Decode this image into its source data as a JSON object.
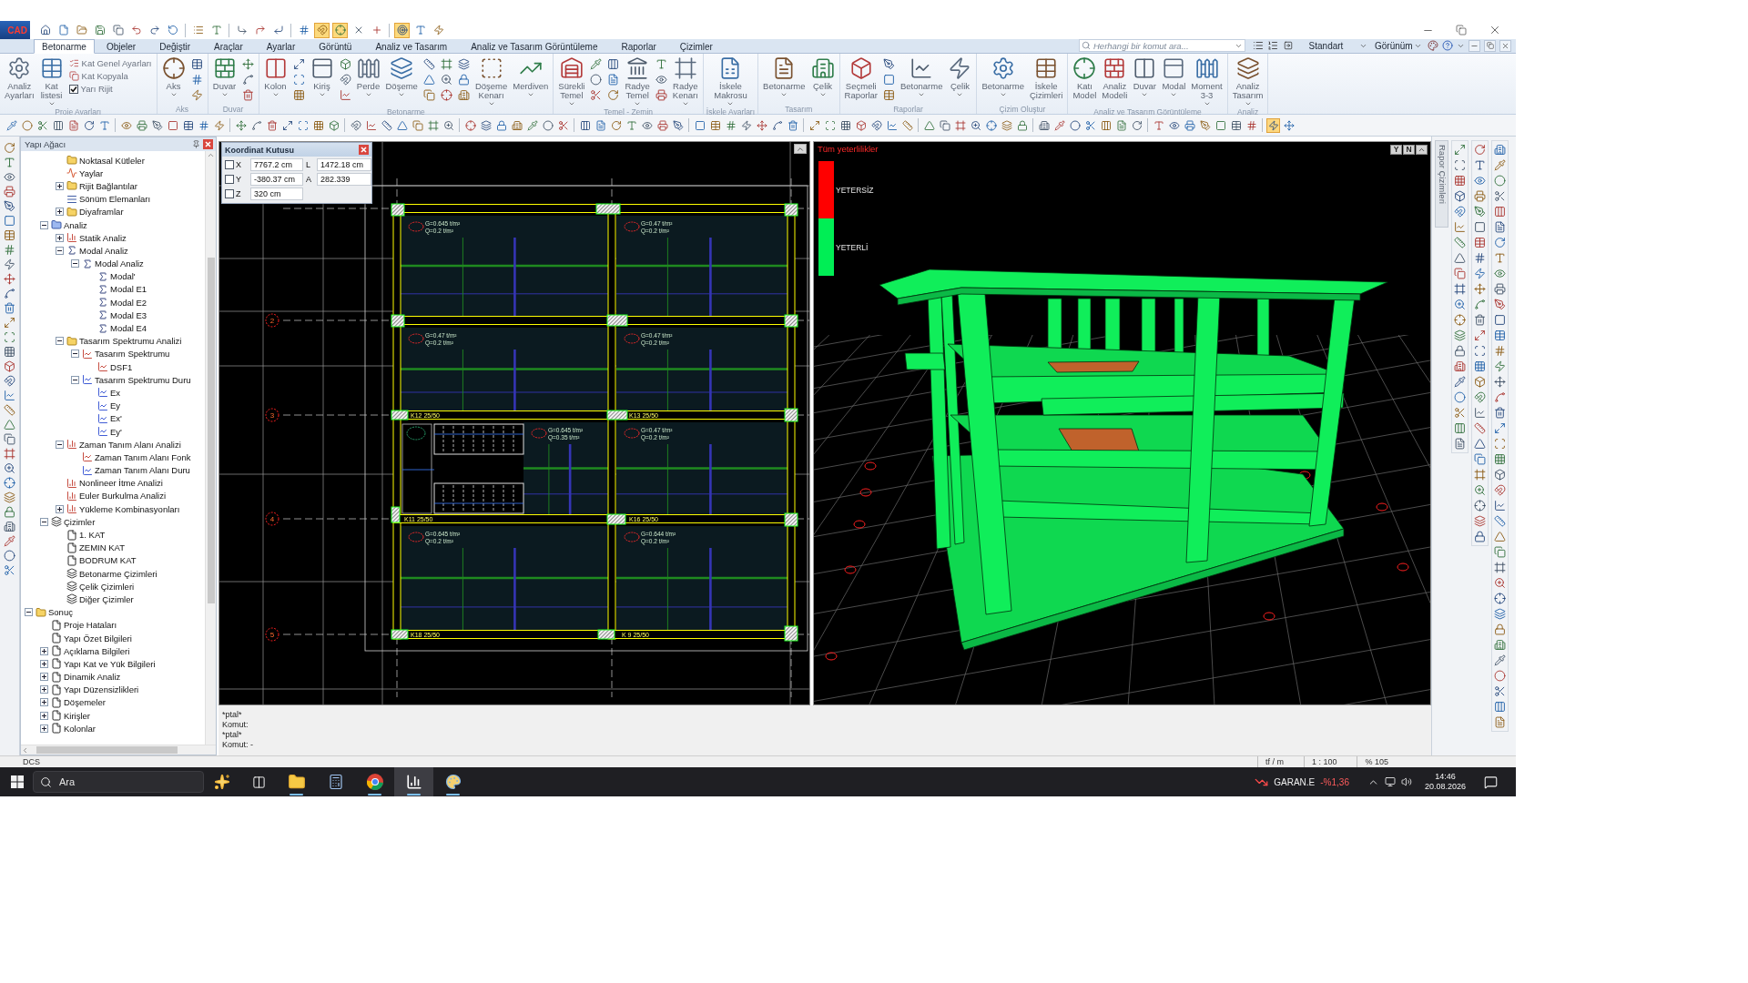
{
  "title_bar": {
    "logo": "CAD",
    "quick_access": [
      {
        "on": false
      },
      {
        "on": false
      },
      {
        "on": false
      },
      {
        "on": false
      },
      {
        "on": false
      },
      {
        "on": false
      },
      {
        "on": false
      },
      {
        "on": false
      },
      {
        "on": false
      },
      {
        "on": false
      },
      {
        "on": false
      },
      {
        "on": false
      },
      {
        "on": false
      },
      {
        "on": false
      },
      {
        "on": true
      },
      {
        "on": true
      },
      {
        "on": false
      },
      {
        "on": false
      },
      {
        "on": true
      },
      {
        "on": false
      },
      {
        "on": false
      }
    ]
  },
  "tabs": [
    {
      "label": "Betonarme",
      "selected": true
    },
    {
      "label": "Objeler",
      "selected": false
    },
    {
      "label": "Değiştir",
      "selected": false
    },
    {
      "label": "Araçlar",
      "selected": false
    },
    {
      "label": "Ayarlar",
      "selected": false
    },
    {
      "label": "Görüntü",
      "selected": false
    },
    {
      "label": "Analiz ve Tasarım",
      "selected": false
    },
    {
      "label": "Analiz ve Tasarım Görüntüleme",
      "selected": false
    },
    {
      "label": "Raporlar",
      "selected": false
    },
    {
      "label": "Çizimler",
      "selected": false
    }
  ],
  "command_search": {
    "placeholder": "Herhangi bir komut ara..."
  },
  "workspace": {
    "value": "Standart"
  },
  "view_menu": {
    "label": "Görünüm"
  },
  "ribbon": {
    "groups": [
      {
        "label": "Proje Ayarları",
        "items": [
          {
            "kind": "large",
            "label": "Analiz Ayarları",
            "dropdown": false
          },
          {
            "kind": "large",
            "label": "Kat listesi",
            "dropdown": true
          },
          {
            "kind": "list",
            "entries": [
              {
                "kind": "item",
                "label": "Kat Genel Ayarları"
              },
              {
                "kind": "item",
                "label": "Kat Kopyala"
              },
              {
                "kind": "check",
                "label": "Yarı Rijit",
                "checked": true
              }
            ]
          }
        ]
      },
      {
        "label": "Aks",
        "items": [
          {
            "kind": "large",
            "label": "Aks",
            "dropdown": true
          },
          {
            "kind": "tools"
          }
        ]
      },
      {
        "label": "Duvar",
        "items": [
          {
            "kind": "large",
            "label": "Duvar",
            "dropdown": true
          },
          {
            "kind": "tools"
          }
        ]
      },
      {
        "label": "Betonarme",
        "items": [
          {
            "kind": "large",
            "label": "Kolon",
            "dropdown": true
          },
          {
            "kind": "tools"
          },
          {
            "kind": "large",
            "label": "Kiriş",
            "dropdown": true
          },
          {
            "kind": "tools"
          },
          {
            "kind": "large",
            "label": "Perde",
            "dropdown": true
          },
          {
            "kind": "large",
            "label": "Döşeme",
            "dropdown": true
          },
          {
            "kind": "tools"
          },
          {
            "kind": "tools"
          },
          {
            "kind": "tools"
          },
          {
            "kind": "large",
            "label": "Döşeme Kenarı",
            "dropdown": true
          },
          {
            "kind": "large",
            "label": "Merdiven",
            "dropdown": true
          }
        ]
      },
      {
        "label": "Temel - Zemin",
        "items": [
          {
            "kind": "large",
            "label": "Sürekli Temel",
            "dropdown": true
          },
          {
            "kind": "tools"
          },
          {
            "kind": "tools"
          },
          {
            "kind": "large",
            "label": "Radye Temel",
            "dropdown": true
          },
          {
            "kind": "tools"
          },
          {
            "kind": "large",
            "label": "Radye Kenarı",
            "dropdown": true
          }
        ]
      },
      {
        "label": "İskele Ayarları",
        "items": [
          {
            "kind": "large",
            "label": "İskele Makrosu",
            "dropdown": true
          }
        ]
      },
      {
        "label": "Tasarım",
        "items": [
          {
            "kind": "large",
            "label": "Betonarme",
            "dropdown": true
          },
          {
            "kind": "large",
            "label": "Çelik",
            "dropdown": true
          }
        ]
      },
      {
        "label": "Raporlar",
        "items": [
          {
            "kind": "large",
            "label": "Seçmeli Raporlar",
            "dropdown": false
          },
          {
            "kind": "tools"
          },
          {
            "kind": "large",
            "label": "Betonarme",
            "dropdown": true
          },
          {
            "kind": "large",
            "label": "Çelik",
            "dropdown": true
          }
        ]
      },
      {
        "label": "Çizim Oluştur",
        "items": [
          {
            "kind": "large",
            "label": "Betonarme",
            "dropdown": true
          },
          {
            "kind": "large",
            "label": "İskele Çizimleri",
            "dropdown": false
          }
        ]
      },
      {
        "label": "Analiz ve Tasarım Görüntüleme",
        "items": [
          {
            "kind": "large",
            "label": "Katı Model",
            "dropdown": false
          },
          {
            "kind": "large",
            "label": "Analiz Modeli",
            "dropdown": false
          },
          {
            "kind": "large",
            "label": "Duvar",
            "dropdown": true
          },
          {
            "kind": "large",
            "label": "Modal",
            "dropdown": true
          },
          {
            "kind": "large",
            "label": "Moment 3-3",
            "dropdown": true
          }
        ]
      },
      {
        "label": "Analiz",
        "items": [
          {
            "kind": "large",
            "label": "Analiz Tasarım",
            "dropdown": true
          }
        ]
      }
    ]
  },
  "toolbar": [
    {
      "on": false
    },
    {
      "on": false
    },
    {
      "on": false
    },
    {
      "on": false
    },
    {
      "on": false
    },
    {
      "on": false
    },
    {
      "on": false
    },
    {
      "on": false
    },
    {
      "on": false
    },
    {
      "on": false
    },
    {
      "on": false
    },
    {
      "on": false
    },
    {
      "on": false
    },
    {
      "on": false
    },
    {
      "on": false
    },
    {
      "on": false
    },
    {
      "on": false
    },
    {
      "on": false
    },
    {
      "on": false
    },
    {
      "on": false
    },
    {
      "on": false
    },
    {
      "on": false
    },
    {
      "on": false
    },
    {
      "on": false
    },
    {
      "on": false
    },
    {
      "on": false
    },
    {
      "on": false
    },
    {
      "on": false
    },
    {
      "on": false
    },
    {
      "on": false
    },
    {
      "on": false
    },
    {
      "on": false
    },
    {
      "on": false
    },
    {
      "on": false
    },
    {
      "on": false
    },
    {
      "on": false
    },
    {
      "on": false
    },
    {
      "on": false
    },
    {
      "on": false
    },
    {
      "on": false
    },
    {
      "on": false
    },
    {
      "on": false
    },
    {
      "on": false
    },
    {
      "on": false
    },
    {
      "on": false
    },
    {
      "on": false
    },
    {
      "on": false
    },
    {
      "on": false
    },
    {
      "on": false
    },
    {
      "on": false
    },
    {
      "on": false
    },
    {
      "on": false
    },
    {
      "on": false
    },
    {
      "on": false
    },
    {
      "on": false
    },
    {
      "on": false
    },
    {
      "on": false
    },
    {
      "on": false
    },
    {
      "on": false
    },
    {
      "on": false
    },
    {
      "on": false
    },
    {
      "on": false
    },
    {
      "on": false
    },
    {
      "on": false
    },
    {
      "on": false
    },
    {
      "on": false
    },
    {
      "on": false
    },
    {
      "on": false
    },
    {
      "on": false
    },
    {
      "on": false
    },
    {
      "on": false
    },
    {
      "on": false
    },
    {
      "on": false
    },
    {
      "on": false
    },
    {
      "on": false
    },
    {
      "on": false
    },
    {
      "on": false
    },
    {
      "on": true
    },
    {
      "on": false
    }
  ],
  "tree": {
    "title": "Yapı Ağacı",
    "items": [
      {
        "children": [
          {
            "children": [
              {
                "label": "Noktasal Kütleler",
                "kind": "folder"
              },
              {
                "label": "Yaylar",
                "kind": "spring"
              },
              {
                "label": "Rijit Bağlantılar",
                "kind": "folder",
                "expanded": false
              },
              {
                "label": "Sönüm Elemanları",
                "kind": "damper"
              },
              {
                "label": "Diyaframlar",
                "kind": "folder",
                "expanded": false
              }
            ]
          },
          {
            "label": "Analiz",
            "kind": "analysis",
            "expanded": true,
            "children": [
              {
                "label": "Statik Analiz",
                "kind": "chart",
                "expanded": false
              },
              {
                "label": "Modal Analiz",
                "kind": "sigma",
                "expanded": true,
                "children": [
                  {
                    "label": "Modal Analiz",
                    "kind": "sigma",
                    "expanded": true,
                    "children": [
                      {
                        "label": "Modal'",
                        "kind": "sigma"
                      },
                      {
                        "label": "Modal E1",
                        "kind": "sigma"
                      },
                      {
                        "label": "Modal E2",
                        "kind": "sigma"
                      },
                      {
                        "label": "Modal E3",
                        "kind": "sigma"
                      },
                      {
                        "label": "Modal E4",
                        "kind": "sigma"
                      }
                    ]
                  }
                ]
              },
              {
                "label": "Tasarım Spektrumu Analizi",
                "kind": "folder",
                "expanded": true,
                "children": [
                  {
                    "label": "Tasarım Spektrumu",
                    "kind": "spectrum",
                    "expanded": true,
                    "children": [
                      {
                        "label": "DSF1",
                        "kind": "spectrum"
                      }
                    ]
                  },
                  {
                    "label": "Tasarım Spektrumu Duru",
                    "kind": "curve",
                    "expanded": true,
                    "children": [
                      {
                        "label": "Ex",
                        "kind": "curve"
                      },
                      {
                        "label": "Ey",
                        "kind": "curve"
                      },
                      {
                        "label": "Ex'",
                        "kind": "curve"
                      },
                      {
                        "label": "Ey'",
                        "kind": "curve"
                      }
                    ]
                  }
                ]
              },
              {
                "label": "Zaman Tanım Alanı Analizi",
                "kind": "chart",
                "expanded": true,
                "children": [
                  {
                    "label": "Zaman Tanım Alanı Fonk",
                    "kind": "spectrum"
                  },
                  {
                    "label": "Zaman Tanım Alanı Duru",
                    "kind": "curve"
                  }
                ]
              },
              {
                "label": "Nonlineer İtme Analizi",
                "kind": "chart"
              },
              {
                "label": "Euler Burkulma Analizi",
                "kind": "chart"
              },
              {
                "label": "Yükleme Kombinasyonları",
                "kind": "chart",
                "expanded": false
              }
            ]
          },
          {
            "label": "Çizimler",
            "kind": "layers",
            "expanded": true,
            "children": [
              {
                "label": "1. KAT",
                "kind": "page"
              },
              {
                "label": "ZEMIN KAT",
                "kind": "page"
              },
              {
                "label": "BODRUM KAT",
                "kind": "page"
              },
              {
                "label": "Betonarme Çizimleri",
                "kind": "layers"
              },
              {
                "label": "Çelik Çizimleri",
                "kind": "layers"
              },
              {
                "label": "Diğer Çizimler",
                "kind": "layers"
              }
            ]
          }
        ]
      },
      {
        "label": "Sonuç",
        "kind": "folder",
        "expanded": true,
        "children": [
          {
            "label": "Proje Hataları",
            "kind": "page"
          },
          {
            "label": "Yapı Özet Bilgileri",
            "kind": "page"
          },
          {
            "label": "Açıklama Bilgileri",
            "kind": "page",
            "expanded": false
          },
          {
            "label": "Yapı Kat ve Yük Bilgileri",
            "kind": "page",
            "expanded": false
          },
          {
            "label": "Dinamik Analiz",
            "kind": "page",
            "expanded": false
          },
          {
            "label": "Yapı Düzensizlikleri",
            "kind": "page",
            "expanded": false
          },
          {
            "label": "Döşemeler",
            "kind": "page",
            "expanded": false
          },
          {
            "label": "Kirişler",
            "kind": "page",
            "expanded": false
          },
          {
            "label": "Kolonlar",
            "kind": "page",
            "expanded": false
          }
        ]
      }
    ]
  },
  "coordinate_box": {
    "title": "Koordinat Kutusu",
    "fields": [
      {
        "axis": "X",
        "checked": false,
        "value": "7767.2 cm",
        "extra_label": "L",
        "extra_value": "1472.18 cm"
      },
      {
        "axis": "Y",
        "checked": false,
        "value": "-380.37 cm",
        "extra_label": "A",
        "extra_value": "282.339"
      },
      {
        "axis": "Z",
        "checked": false,
        "value": "320 cm"
      }
    ]
  },
  "floor_plan": {
    "axes": [
      "2",
      "3",
      "4",
      "5"
    ],
    "slabs": [
      {
        "load_g": "G=0.645 t/m²",
        "load_q": "Q=0.2 t/m²"
      },
      {
        "load_g": "G=0.47 t/m²",
        "load_q": "Q=0.2 t/m²"
      },
      {
        "load_g": "G=0.47 t/m²",
        "load_q": "Q=0.2 t/m²"
      },
      {
        "load_g": "G=0.47 t/m²",
        "load_q": "Q=0.2 t/m²"
      },
      {
        "load_g": "G=0.645 t/m²",
        "load_q": "Q=0.35 t/m²"
      },
      {
        "load_g": "G=0.47 t/m²",
        "load_q": "Q=0.2 t/m²"
      },
      {
        "load_g": "G=0.645 t/m²",
        "load_q": "Q=0.2 t/m²"
      },
      {
        "load_g": "G=0.644 t/m²",
        "load_q": "Q=0.2 t/m²"
      }
    ],
    "beams": [
      "K12 25/50",
      "K13 25/50",
      "K11 25/50",
      "K16 25/50",
      "K18 25/50",
      "K 9 25/50"
    ]
  },
  "model_view": {
    "title": "Tüm yeterlilikler",
    "legend": [
      {
        "label": "YETERSİZ",
        "color": "#ff0000"
      },
      {
        "label": "YETERLİ",
        "color": "#00ee55"
      }
    ],
    "view_buttons": [
      "Y",
      "N"
    ]
  },
  "side_tab": {
    "label": "Rapor Çizimleri"
  },
  "command_log": [
    "*ptal*",
    "Komut:",
    "*ptal*",
    "Komut: -"
  ],
  "status_bar": {
    "mode": "DCS",
    "fields": [
      "tf / m",
      "1 : 100",
      "% 105"
    ]
  },
  "taskbar": {
    "search": {
      "placeholder": "Ara"
    },
    "apps": [
      {
        "kind": "explorer",
        "running": true,
        "selected": false
      },
      {
        "kind": "calculator",
        "running": false,
        "selected": false
      },
      {
        "kind": "browser",
        "running": true,
        "selected": false
      },
      {
        "kind": "dashboard",
        "running": true,
        "selected": true
      },
      {
        "kind": "cad",
        "running": true,
        "selected": false
      }
    ],
    "stock": {
      "symbol": "GARAN.E",
      "change": "-%1,36"
    },
    "clock": {
      "time": "14:46",
      "date": "20.08.2026"
    }
  }
}
